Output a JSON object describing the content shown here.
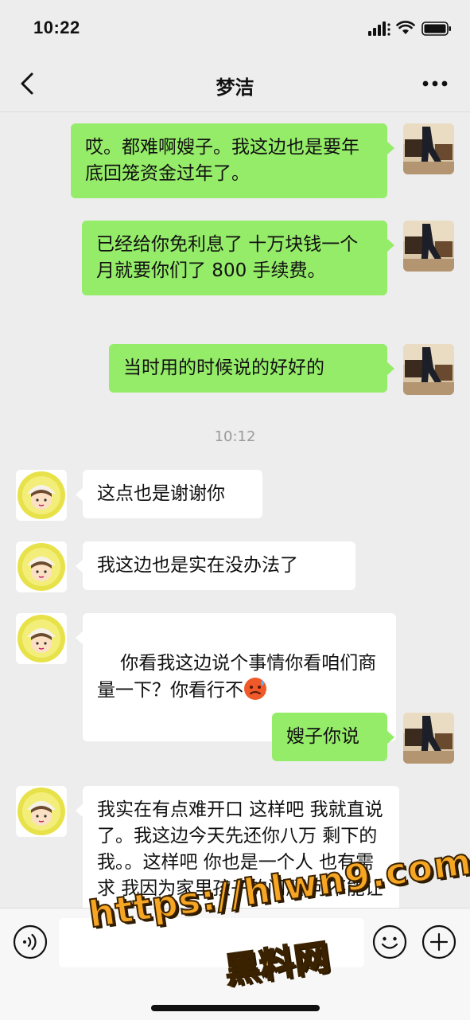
{
  "status_bar": {
    "time": "10:22"
  },
  "nav": {
    "title": "梦洁"
  },
  "messages": [
    {
      "side": "sent",
      "text": "哎。都难啊嫂子。我这边也是要年底回笼资金过年了。"
    },
    {
      "side": "sent",
      "text": "已经给你免利息了 十万块钱一个月就要你们了 800 手续费。"
    },
    {
      "side": "sent",
      "text": "当时用的时候说的好好的"
    },
    {
      "side": "time",
      "text": "10:12"
    },
    {
      "side": "recv",
      "text": "这点也是谢谢你"
    },
    {
      "side": "recv",
      "text": "我这边也是实在没办法了"
    },
    {
      "side": "recv",
      "text": "你看我这边说个事情你看咱们商量一下？你看行不",
      "emoji": "cold-sweat-face"
    },
    {
      "side": "sent",
      "text": "嫂子你说"
    },
    {
      "side": "recv",
      "text": "我实在有点难开口 这样吧 我就直说了。我这边今天先还你八万 剩下的 我。。这样吧 你也是一个人 也有需求 我因为家里孩子的问题 可不能让你帮"
    }
  ],
  "input_bar": {
    "voice_icon": "voice-icon",
    "emoji_icon": "emoji-icon",
    "plus_icon": "plus-icon"
  },
  "watermark": {
    "line1": "https://hlwn9.com",
    "line2": "黑料网"
  },
  "colors": {
    "sent_bubble": "#95ec69",
    "recv_bubble": "#ffffff",
    "background": "#ededed",
    "watermark": "#f6a623"
  }
}
